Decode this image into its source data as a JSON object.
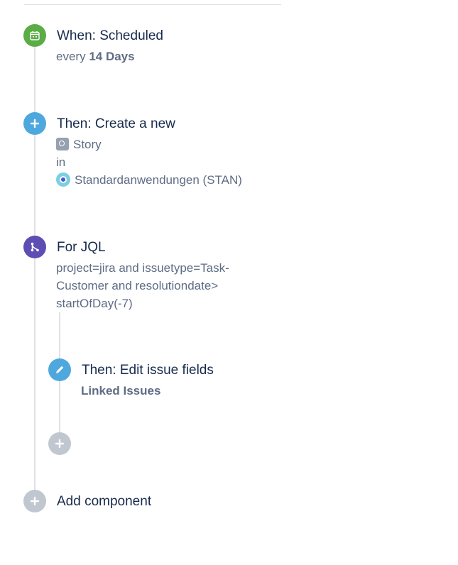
{
  "rule": {
    "trigger": {
      "title": "When: Scheduled",
      "every_prefix": "every",
      "every_value": "14 Days",
      "icon": "calendar-icon"
    },
    "create_action": {
      "title": "Then: Create a new",
      "issue_type": "Story",
      "in_label": "in",
      "project": "Standardanwendungen (STAN)",
      "icon": "plus-icon"
    },
    "branch": {
      "title": "For JQL",
      "jql_lines": [
        "project=jira and issuetype=Task-",
        "Customer and resolutiondate>",
        "startOfDay(-7)"
      ],
      "icon": "branch-icon",
      "edit_action": {
        "title": "Then: Edit issue fields",
        "field": "Linked Issues",
        "icon": "pencil-icon"
      },
      "add_button_icon": "plus-icon"
    },
    "add_component": {
      "label": "Add component",
      "icon": "plus-icon"
    }
  },
  "colors": {
    "trigger": "#5aac44",
    "action": "#4ea8de",
    "branch": "#5e4db2",
    "add": "#c1c7d0",
    "title_text": "#172b4d",
    "body_text": "#5e6c84"
  }
}
